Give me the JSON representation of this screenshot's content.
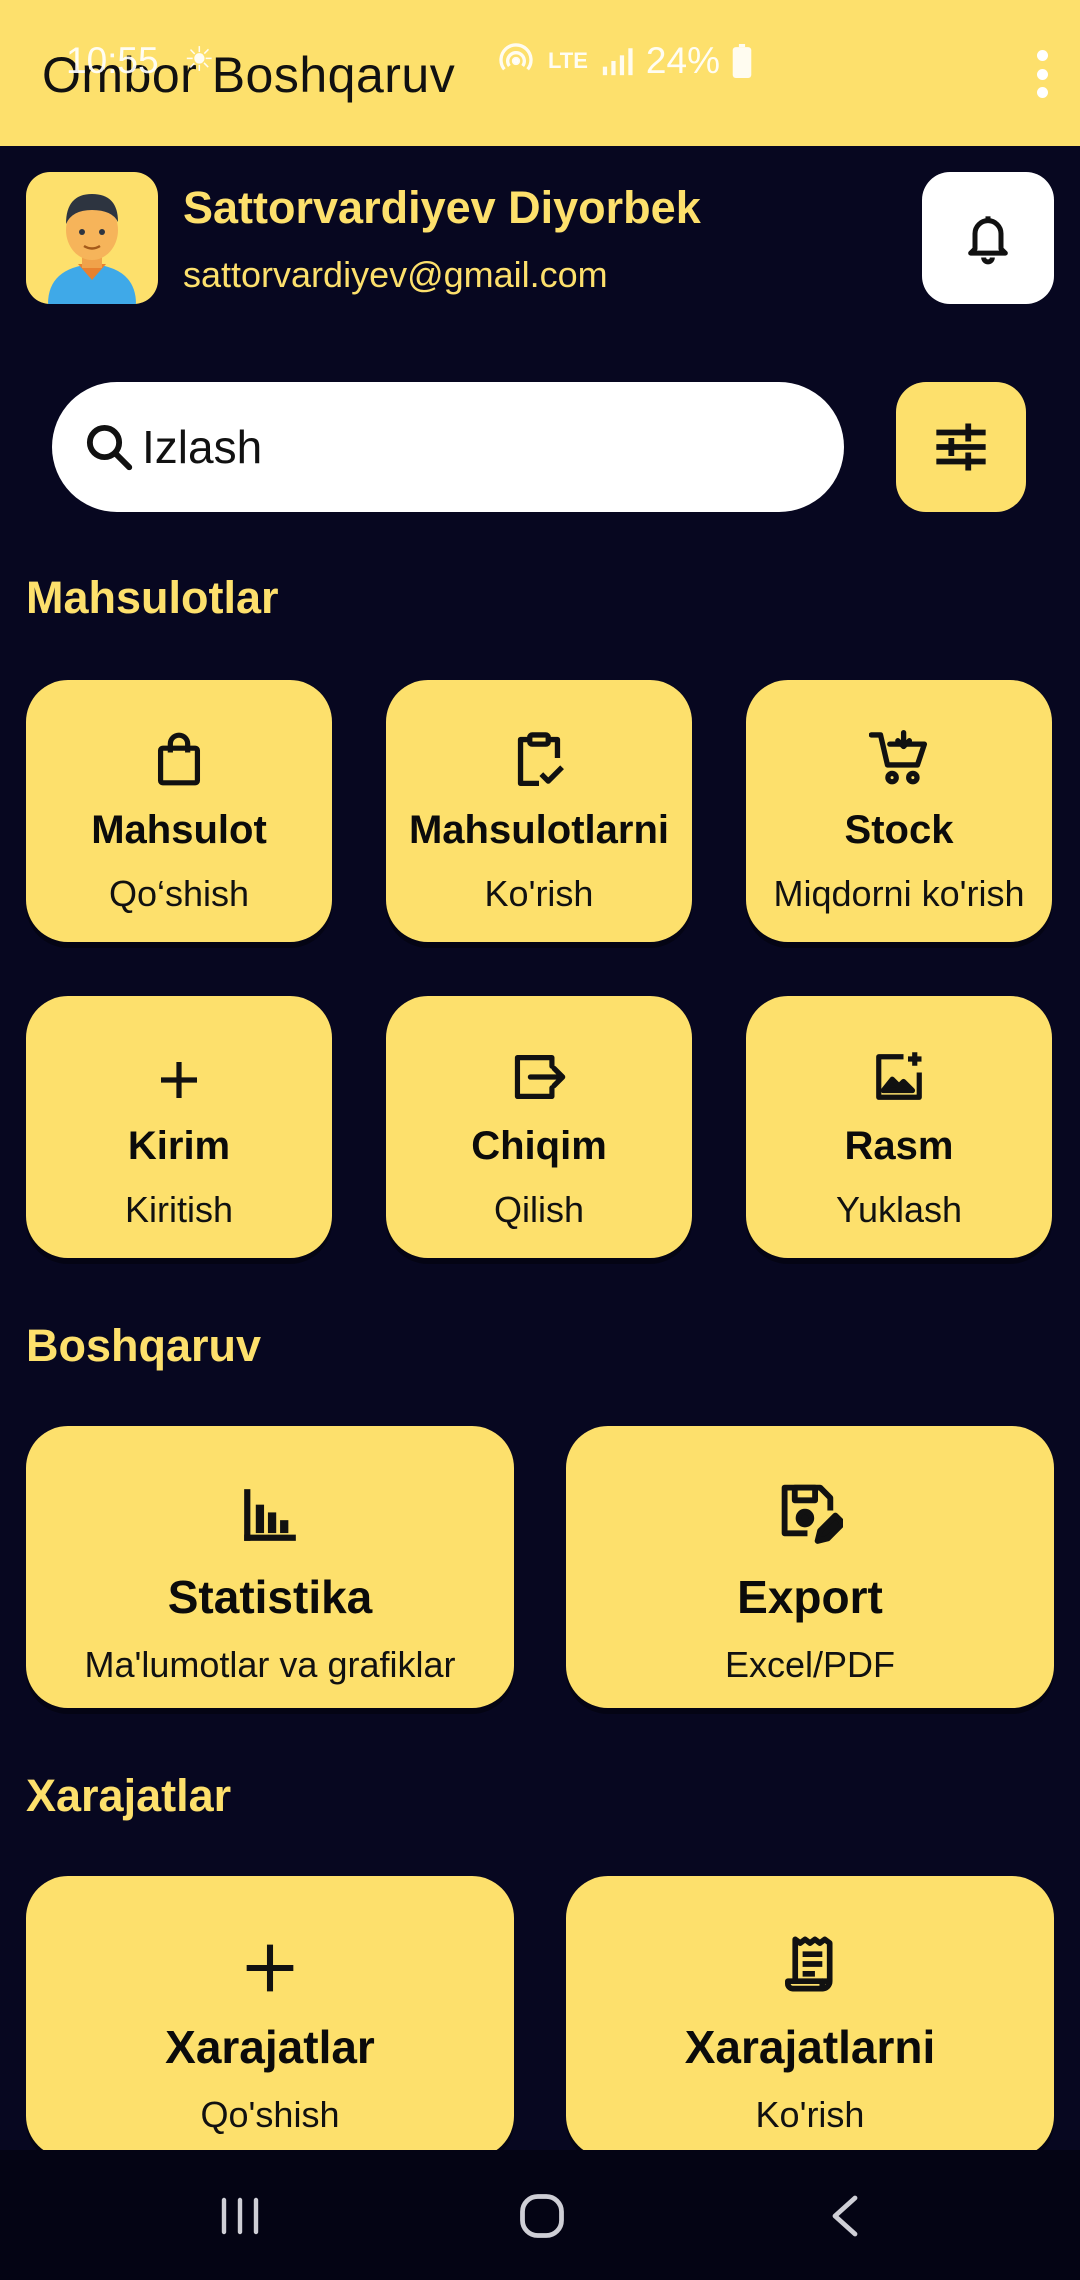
{
  "status_bar": {
    "time": "10:55",
    "battery": "24%",
    "network": "LTE"
  },
  "app_bar": {
    "title": "Ombor Boshqaruv",
    "menu_icon": "more-vert-icon"
  },
  "profile": {
    "name": "Sattorvardiyev Diyorbek",
    "email": "sattorvardiyev@gmail.com",
    "avatar_icon": "person-avatar-icon",
    "notifications_icon": "bell-icon"
  },
  "search": {
    "placeholder": "Izlash",
    "value": "",
    "filter_icon": "tune-icon"
  },
  "sections": {
    "products": {
      "title": "Mahsulotlar",
      "cards": [
        {
          "title": "Mahsulot",
          "subtitle": "Qo‘shish",
          "icon": "shopping-bag-icon"
        },
        {
          "title": "Mahsulotlarni",
          "subtitle": "Ko'rish",
          "icon": "clipboard-check-icon"
        },
        {
          "title": "Stock",
          "subtitle": "Miqdorni ko'rish",
          "icon": "cart-icon"
        },
        {
          "title": "Kirim",
          "subtitle": "Kiritish",
          "icon": "plus-icon"
        },
        {
          "title": "Chiqim",
          "subtitle": "Qilish",
          "icon": "exit-icon"
        },
        {
          "title": "Rasm",
          "subtitle": "Yuklash",
          "icon": "add-photo-icon"
        }
      ]
    },
    "management": {
      "title": "Boshqaruv",
      "cards": [
        {
          "title": "Statistika",
          "subtitle": "Ma'lumotlar va grafiklar",
          "icon": "bar-chart-icon"
        },
        {
          "title": "Export",
          "subtitle": "Excel/PDF",
          "icon": "save-edit-icon"
        }
      ]
    },
    "expenses": {
      "title": "Xarajatlar",
      "cards": [
        {
          "title": "Xarajatlar",
          "subtitle": "Qo'shish",
          "icon": "plus-icon"
        },
        {
          "title": "Xarajatlarni",
          "subtitle": "Ko'rish",
          "icon": "receipt-icon"
        }
      ]
    }
  },
  "colors": {
    "background": "#070720",
    "accent": "#fde06c"
  }
}
